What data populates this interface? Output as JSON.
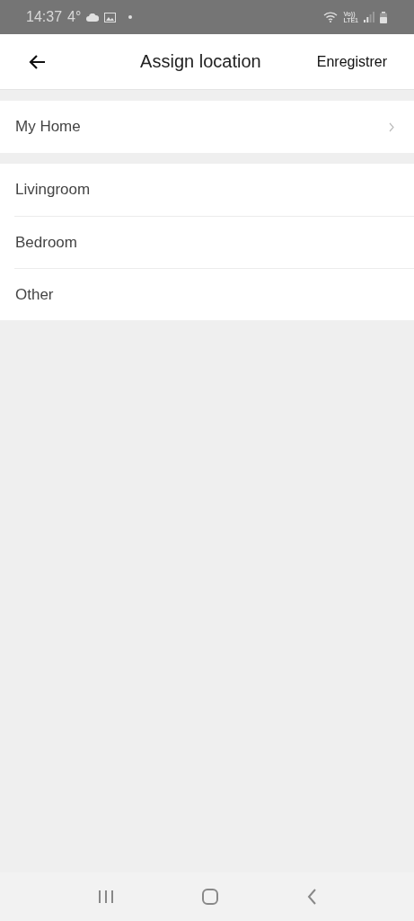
{
  "status_bar": {
    "time": "14:37",
    "temperature": "4°",
    "network_top": "Vo))",
    "network_bottom": "LTE1"
  },
  "header": {
    "title": "Assign location",
    "action": "Enregistrer"
  },
  "home": {
    "label": "My Home"
  },
  "rooms": [
    {
      "label": "Livingroom"
    },
    {
      "label": "Bedroom"
    },
    {
      "label": "Other"
    }
  ]
}
